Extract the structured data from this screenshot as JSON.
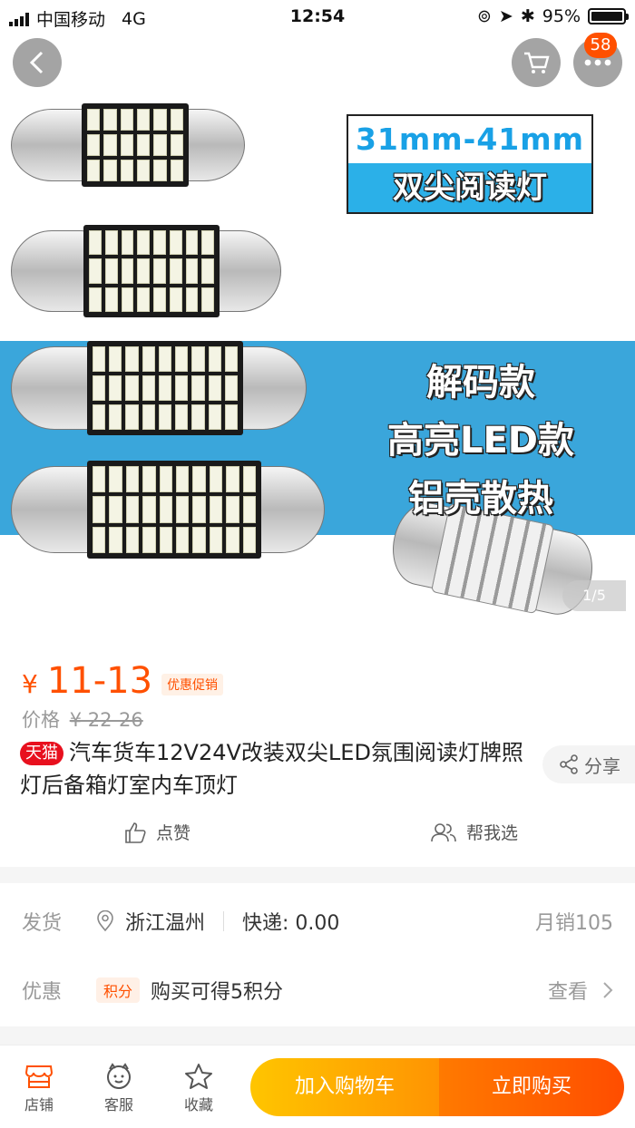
{
  "status_bar": {
    "carrier": "中国移动",
    "network": "4G",
    "time": "12:54",
    "battery": "95%"
  },
  "nav": {
    "cart_badge": "58"
  },
  "hero": {
    "promo_line1": "31mm-41mm",
    "promo_line2": "双尖阅读灯",
    "band_lines": [
      "解码款",
      "高亮LED款",
      "铝壳散热"
    ],
    "page_indicator": "1/5"
  },
  "price": {
    "currency": "¥",
    "range": "11-13",
    "promo_tag": "优惠促销",
    "original_label": "价格",
    "original_value": "¥ 22-26"
  },
  "product": {
    "store_badge": "天猫",
    "title": "汽车货车12V24V改装双尖LED氛围阅读灯牌照灯后备箱灯室内车顶灯",
    "share_label": "分享"
  },
  "actions": {
    "like_label": "点赞",
    "help_label": "帮我选"
  },
  "shipping": {
    "label": "发货",
    "location": "浙江温州",
    "express": "快递: 0.00",
    "monthly_sales": "月销105"
  },
  "promotion": {
    "label": "优惠",
    "tag": "积分",
    "text": "购买可得5积分",
    "view_label": "查看"
  },
  "bottom_bar": {
    "tabs": [
      {
        "label": "店铺",
        "icon": "store-icon"
      },
      {
        "label": "客服",
        "icon": "customer-service-icon"
      },
      {
        "label": "收藏",
        "icon": "star-icon"
      }
    ],
    "add_to_cart": "加入购物车",
    "buy_now": "立即购买"
  },
  "colors": {
    "accent": "#ff5000",
    "tmall_red": "#e8101e",
    "band_blue": "#3aa6db"
  }
}
